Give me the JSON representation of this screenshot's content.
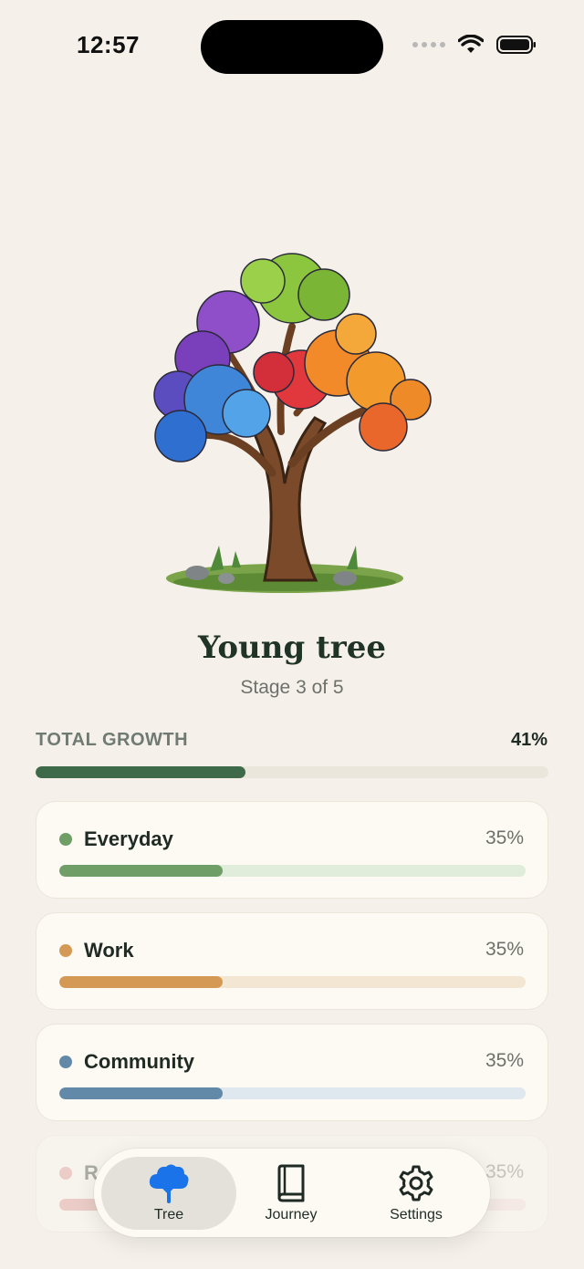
{
  "status_bar": {
    "time": "12:57"
  },
  "tree": {
    "stage_title": "Young tree",
    "stage_subtitle": "Stage 3 of 5"
  },
  "total_growth": {
    "label": "TOTAL GROWTH",
    "percent_text": "41%",
    "value": 0.41,
    "color": "#3f6a4a"
  },
  "categories": [
    {
      "name": "Everyday",
      "percent_text": "35%",
      "value": 0.35,
      "color": "#6f9e67",
      "track": "#e1eddb"
    },
    {
      "name": "Work",
      "percent_text": "35%",
      "value": 0.35,
      "color": "#d49a55",
      "track": "#f3e6d2"
    },
    {
      "name": "Community",
      "percent_text": "35%",
      "value": 0.35,
      "color": "#6289a8",
      "track": "#dfe8ef"
    },
    {
      "name": "R",
      "percent_text": "35%",
      "value": 0.35,
      "color": "#d98a86",
      "track": "#f3dcd9"
    }
  ],
  "tabs": [
    {
      "label": "Tree",
      "icon": "tree-icon",
      "active": true,
      "color": "#1a73e8"
    },
    {
      "label": "Journey",
      "icon": "book-icon",
      "active": false
    },
    {
      "label": "Settings",
      "icon": "gear-icon",
      "active": false
    }
  ]
}
